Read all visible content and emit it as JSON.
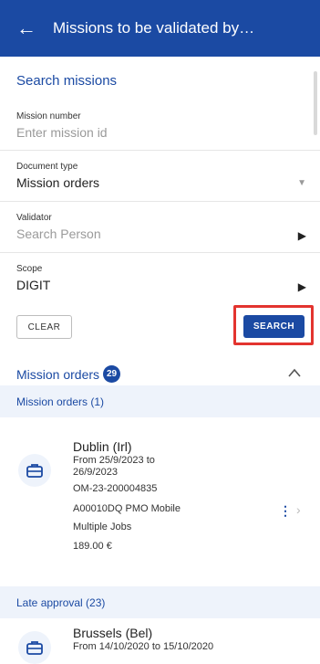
{
  "header": {
    "title": "Missions to be validated by…",
    "back_icon": "arrow-left-icon"
  },
  "search": {
    "title": "Search missions",
    "mission_number": {
      "label": "Mission number",
      "placeholder": "Enter mission id"
    },
    "document_type": {
      "label": "Document type",
      "value": "Mission orders"
    },
    "validator": {
      "label": "Validator",
      "placeholder": "Search Person"
    },
    "scope": {
      "label": "Scope",
      "value": "DIGIT"
    },
    "clear_label": "CLEAR",
    "search_label": "SEARCH"
  },
  "results": {
    "group_title": "Mission orders",
    "group_count": "29",
    "sections": [
      {
        "title": "Mission orders (1)",
        "items": [
          {
            "city": "Dublin (Irl)",
            "dates_line1": "From 25/9/2023 to",
            "dates_line2": "26/9/2023",
            "reference": "OM-23-200004835",
            "description": "A00010DQ PMO Mobile",
            "category": "Multiple Jobs",
            "amount": "189.00 €"
          }
        ]
      },
      {
        "title": "Late approval (23)",
        "items": [
          {
            "city": "Brussels (Bel)",
            "dates_line1": "From 14/10/2020 to 15/10/2020"
          }
        ]
      }
    ]
  },
  "colors": {
    "primary": "#1b4aa3",
    "highlight": "#e3342f",
    "section_bg": "#eef3fb"
  }
}
